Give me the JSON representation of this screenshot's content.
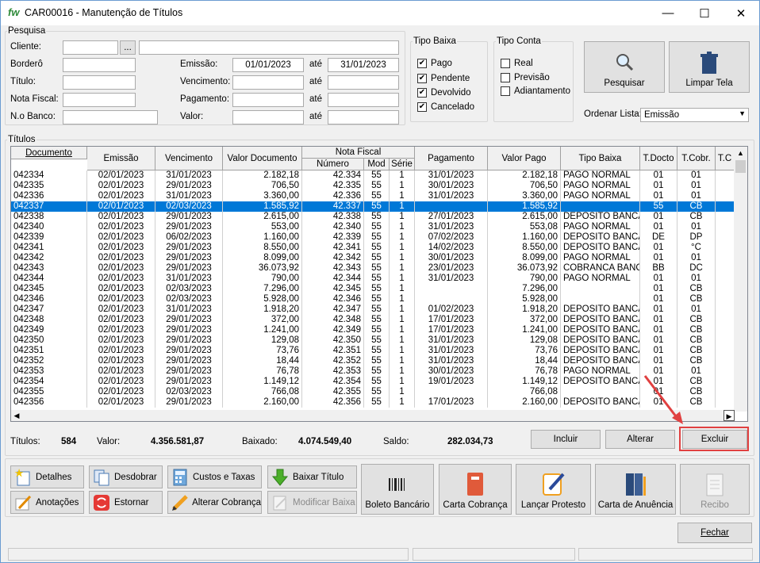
{
  "window": {
    "title": "CAR00016 - Manutenção de Títulos",
    "logo": "fw"
  },
  "pesquisa": {
    "legend": "Pesquisa",
    "cliente_label": "Cliente:",
    "browse_label": "...",
    "bordero_label": "Borderô",
    "titulo_label": "Título:",
    "nota_fiscal_label": "Nota Fiscal:",
    "no_banco_label": "N.o Banco:",
    "emissao_label": "Emissão:",
    "emissao_de": "01/01/2023",
    "ate_label": "até",
    "emissao_ate": "31/01/2023",
    "vencimento_label": "Vencimento:",
    "pagamento_label": "Pagamento:",
    "valor_label": "Valor:"
  },
  "tipo_baixa": {
    "legend": "Tipo Baixa",
    "items": [
      {
        "label": "Pago",
        "checked": true
      },
      {
        "label": "Pendente",
        "checked": true
      },
      {
        "label": "Devolvido",
        "checked": true
      },
      {
        "label": "Cancelado",
        "checked": true
      }
    ]
  },
  "tipo_conta": {
    "legend": "Tipo Conta",
    "items": [
      {
        "label": "Real",
        "checked": false
      },
      {
        "label": "Previsão",
        "checked": false
      },
      {
        "label": "Adiantamento",
        "checked": false
      }
    ]
  },
  "actions": {
    "pesquisar": "Pesquisar",
    "limpar": "Limpar Tela",
    "ordenar_label": "Ordenar Lista:",
    "ordenar_value": "Emissão"
  },
  "titulos": {
    "legend": "Títulos",
    "columns": {
      "documento": "Documento",
      "emissao": "Emissão",
      "vencimento": "Vencimento",
      "valor_doc": "Valor Documento",
      "nota_fiscal": "Nota Fiscal",
      "numero": "Número",
      "mod": "Mod",
      "serie": "Série",
      "pagamento": "Pagamento",
      "valor_pago": "Valor Pago",
      "tipo_baixa": "Tipo Baixa",
      "tdocto": "T.Docto",
      "tcobr": "T.Cobr.",
      "tc": "T.C"
    },
    "rows": [
      [
        "042334",
        "02/01/2023",
        "31/01/2023",
        "2.182,18",
        "42.334",
        "55",
        "1",
        "31/01/2023",
        "2.182,18",
        "PAGO NORMAL",
        "01",
        "01"
      ],
      [
        "042335",
        "02/01/2023",
        "29/01/2023",
        "706,50",
        "42.335",
        "55",
        "1",
        "30/01/2023",
        "706,50",
        "PAGO NORMAL",
        "01",
        "01"
      ],
      [
        "042336",
        "02/01/2023",
        "31/01/2023",
        "3.360,00",
        "42.336",
        "55",
        "1",
        "31/01/2023",
        "3.360,00",
        "PAGO NORMAL",
        "01",
        "01"
      ],
      [
        "042337",
        "02/01/2023",
        "02/03/2023",
        "1.585,92",
        "42.337",
        "55",
        "1",
        "",
        "1.585,92",
        "",
        "55",
        "CB"
      ],
      [
        "042338",
        "02/01/2023",
        "29/01/2023",
        "2.615,00",
        "42.338",
        "55",
        "1",
        "27/01/2023",
        "2.615,00",
        "DEPOSITO BANCA",
        "01",
        "CB"
      ],
      [
        "042340",
        "02/01/2023",
        "29/01/2023",
        "553,00",
        "42.340",
        "55",
        "1",
        "31/01/2023",
        "553,08",
        "PAGO NORMAL",
        "01",
        "01"
      ],
      [
        "042339",
        "02/01/2023",
        "06/02/2023",
        "1.160,00",
        "42.339",
        "55",
        "1",
        "07/02/2023",
        "1.160,00",
        "DEPOSITO BANCA",
        "DE",
        "DP"
      ],
      [
        "042341",
        "02/01/2023",
        "29/01/2023",
        "8.550,00",
        "42.341",
        "55",
        "1",
        "14/02/2023",
        "8.550,00",
        "DEPOSITO BANCA",
        "01",
        "°C"
      ],
      [
        "042342",
        "02/01/2023",
        "29/01/2023",
        "8.099,00",
        "42.342",
        "55",
        "1",
        "30/01/2023",
        "8.099,00",
        "PAGO NORMAL",
        "01",
        "01"
      ],
      [
        "042343",
        "02/01/2023",
        "29/01/2023",
        "36.073,92",
        "42.343",
        "55",
        "1",
        "23/01/2023",
        "36.073,92",
        "COBRANCA BANCA",
        "BB",
        "DC"
      ],
      [
        "042344",
        "02/01/2023",
        "31/01/2023",
        "790,00",
        "42.344",
        "55",
        "1",
        "31/01/2023",
        "790,00",
        "PAGO NORMAL",
        "01",
        "01"
      ],
      [
        "042345",
        "02/01/2023",
        "02/03/2023",
        "7.296,00",
        "42.345",
        "55",
        "1",
        "",
        "7.296,00",
        "",
        "01",
        "CB"
      ],
      [
        "042346",
        "02/01/2023",
        "02/03/2023",
        "5.928,00",
        "42.346",
        "55",
        "1",
        "",
        "5.928,00",
        "",
        "01",
        "CB"
      ],
      [
        "042347",
        "02/01/2023",
        "31/01/2023",
        "1.918,20",
        "42.347",
        "55",
        "1",
        "01/02/2023",
        "1.918,20",
        "DEPOSITO BANCA",
        "01",
        "01"
      ],
      [
        "042348",
        "02/01/2023",
        "29/01/2023",
        "372,00",
        "42.348",
        "55",
        "1",
        "17/01/2023",
        "372,00",
        "DEPOSITO BANCA",
        "01",
        "CB"
      ],
      [
        "042349",
        "02/01/2023",
        "29/01/2023",
        "1.241,00",
        "42.349",
        "55",
        "1",
        "17/01/2023",
        "1.241,00",
        "DEPOSITO BANCA",
        "01",
        "CB"
      ],
      [
        "042350",
        "02/01/2023",
        "29/01/2023",
        "129,08",
        "42.350",
        "55",
        "1",
        "31/01/2023",
        "129,08",
        "DEPOSITO BANCA",
        "01",
        "CB"
      ],
      [
        "042351",
        "02/01/2023",
        "29/01/2023",
        "73,76",
        "42.351",
        "55",
        "1",
        "31/01/2023",
        "73,76",
        "DEPOSITO BANCA",
        "01",
        "CB"
      ],
      [
        "042352",
        "02/01/2023",
        "29/01/2023",
        "18,44",
        "42.352",
        "55",
        "1",
        "31/01/2023",
        "18,44",
        "DEPOSITO BANCA",
        "01",
        "CB"
      ],
      [
        "042353",
        "02/01/2023",
        "29/01/2023",
        "76,78",
        "42.353",
        "55",
        "1",
        "30/01/2023",
        "76,78",
        "PAGO NORMAL",
        "01",
        "01"
      ],
      [
        "042354",
        "02/01/2023",
        "29/01/2023",
        "1.149,12",
        "42.354",
        "55",
        "1",
        "19/01/2023",
        "1.149,12",
        "DEPOSITO BANCA",
        "01",
        "CB"
      ],
      [
        "042355",
        "02/01/2023",
        "02/03/2023",
        "766,08",
        "42.355",
        "55",
        "1",
        "",
        "766,08",
        "",
        "01",
        "CB"
      ],
      [
        "042356",
        "02/01/2023",
        "29/01/2023",
        "2.160,00",
        "42.356",
        "55",
        "1",
        "17/01/2023",
        "2.160,00",
        "DEPOSITO BANCA",
        "01",
        "CB"
      ]
    ],
    "selected_index": 3
  },
  "totals": {
    "titulos_label": "Títulos:",
    "titulos": "584",
    "valor_label": "Valor:",
    "valor": "4.356.581,87",
    "baixado_label": "Baixado:",
    "baixado": "4.074.549,40",
    "saldo_label": "Saldo:",
    "saldo": "282.034,73"
  },
  "row_buttons": {
    "incluir": "Incluir",
    "alterar": "Alterar",
    "excluir": "Excluir"
  },
  "bottom": {
    "detalhes": "Detalhes",
    "desdobrar": "Desdobrar",
    "custos": "Custos e Taxas",
    "baixar": "Baixar Título",
    "anotacoes": "Anotações",
    "estornar": "Estornar",
    "alterar_cobranca": "Alterar Cobrança",
    "modificar_baixa": "Modificar Baixa",
    "boleto": "Boleto Bancário",
    "carta_cobranca": "Carta Cobrança",
    "lancar_protesto": "Lançar Protesto",
    "carta_anuencia": "Carta de Anuência",
    "recibo": "Recibo",
    "fechar": "Fechar"
  },
  "colors": {
    "selection": "#0078d7",
    "highlight": "#e04040"
  }
}
